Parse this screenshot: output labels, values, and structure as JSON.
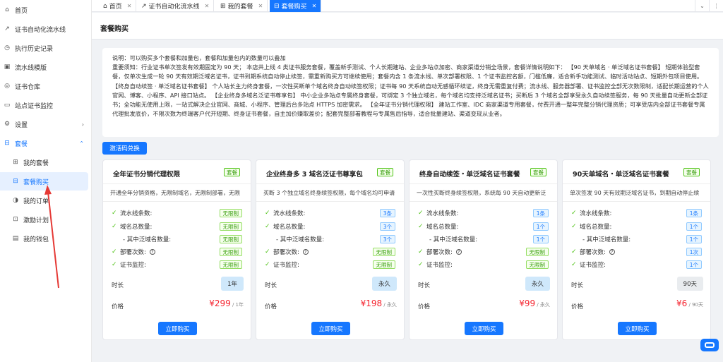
{
  "sidebar": {
    "items": [
      {
        "label": "首页",
        "icon": "home-icon",
        "glyph": "⌂"
      },
      {
        "label": "证书自动化流水线",
        "icon": "trend-icon",
        "glyph": "↗"
      },
      {
        "label": "执行历史记录",
        "icon": "history-icon",
        "glyph": "◷"
      },
      {
        "label": "流水线模版",
        "icon": "template-icon",
        "glyph": "▣"
      },
      {
        "label": "证书仓库",
        "icon": "shield-icon",
        "glyph": "◎"
      },
      {
        "label": "站点证书监控",
        "icon": "monitor-icon",
        "glyph": "▭"
      },
      {
        "label": "设置",
        "icon": "gear-icon",
        "glyph": "⚙"
      },
      {
        "label": "套餐",
        "icon": "cart-icon",
        "glyph": "⊟"
      },
      {
        "label": "我的套餐",
        "icon": "package-icon",
        "glyph": "⊞"
      },
      {
        "label": "套餐购买",
        "icon": "cart-icon",
        "glyph": "⊟"
      },
      {
        "label": "我的订单",
        "icon": "order-icon",
        "glyph": "◑"
      },
      {
        "label": "激励计划",
        "icon": "gift-icon",
        "glyph": "⊡"
      },
      {
        "label": "我的钱包",
        "icon": "wallet-icon",
        "glyph": "▤"
      }
    ]
  },
  "tabs": [
    {
      "label": "首页",
      "icon": "home-icon",
      "glyph": "⌂"
    },
    {
      "label": "证书自动化流水线",
      "icon": "trend-icon",
      "glyph": "↗"
    },
    {
      "label": "我的套餐",
      "icon": "package-icon",
      "glyph": "⊞"
    },
    {
      "label": "套餐购买",
      "icon": "cart-icon",
      "glyph": "⊟"
    }
  ],
  "page_title": "套餐购买",
  "notice": {
    "line1": "说明：可以购买多个套餐和加量包，套餐和加量包内的数量可以叠加",
    "body": "重要须知：行业证书单次签发有效期固定为 90 天； 本店共上线 4 类证书服务套餐，覆盖新手测试、个人长期建站、企业多站点加密、商家渠道分销全场景，套餐详情说明如下： 【90 天单域名 · 单泛域名证书套餐】 短期体验型套餐，仅单次生成一轮 90 天有效期泛域名证书，证书到期系统自动停止续签，需重新购买方可继续使用；套餐内含 1 条流水线、单次部署权限、1 个证书监控名额，门槛低廉，适合新手功能测试、临时活动站点、短期外包项目使用。 【终身自动续签 · 单泛域名证书套餐】 个人站长主力终身套餐，一次性买断单个域名终身自动续签权限；证书每 90 天系统自动无感循环续证，终身无需重复付费；流水线、服务器部署、证书监控全部无次数限制，适配长期运营的个人官网、博客、小程序、API 接口站点。 【企业终身多域名泛证书尊享包】 中小企业多站点专属终身套餐，可绑定 3 个独立域名，每个域名均支持泛域名证书；买断后 3 个域名全部享受永久自动续签服务，每 90 天批量自动更新全部证书；全功能无使用上限，一站式解决企业官网、商城、小程序、管理后台多站点 HTTPS 加密需求。 【全年证书分销代理权限】 建站工作室、IDC 商家渠道专用套餐，付费开通一整年完整分销代理资质；可享受店内全部证书套餐专属代理批发底价，不限次数为终端客户代开短期、终身证书套餐，自主加价赚取差价；配套完整部署教程与专属售后指导，适合批量建站、渠道变现从业者。"
  },
  "redeem_label": "激活码兑换",
  "tag_label": "套餐",
  "labels": {
    "pipelines": "流水线条数:",
    "domains": "域名总数量:",
    "wildcards": "- 其中泛域名数量:",
    "deploys": "部署次数:",
    "monitors": "证书监控:",
    "duration": "时长",
    "price": "价格",
    "buy": "立即购买",
    "deploy_help": "?"
  },
  "cards": [
    {
      "title": "全年证书分销代理权限",
      "desc": "开通全年分销资格，无限制域名，无限制部署，无限",
      "pipelines": "无限制",
      "domains": "无限制",
      "wildcards": "无限制",
      "deploys": "无限制",
      "monitors": "无限制",
      "badge_colors": [
        "green",
        "green",
        "green",
        "green",
        "green"
      ],
      "duration": "1年",
      "price": "¥299",
      "unit": " / 1年"
    },
    {
      "title": "企业终身多 3 域名泛证书尊享包",
      "desc": "买断 3 个独立域名终身续签权限，每个域名均可申请",
      "pipelines": "3条",
      "domains": "3个",
      "wildcards": "3个",
      "deploys": "无限制",
      "monitors": "无限制",
      "badge_colors": [
        "blue",
        "blue",
        "blue",
        "green",
        "green"
      ],
      "duration": "永久",
      "price": "¥198",
      "unit": " / 永久"
    },
    {
      "title": "终身自动续签・单泛域名证书套餐",
      "desc": "一次性买断终身续签权限，系统每 90 天自动更新泛",
      "pipelines": "1条",
      "domains": "1个",
      "wildcards": "1个",
      "deploys": "无限制",
      "monitors": "无限制",
      "badge_colors": [
        "blue",
        "blue",
        "blue",
        "green",
        "green"
      ],
      "duration": "永久",
      "price": "¥99",
      "unit": " / 永久"
    },
    {
      "title": "90天单域名・单泛域名证书套餐",
      "desc": "单次签发 90 天有效期泛域名证书，到期自动停止续",
      "pipelines": "1条",
      "domains": "1个",
      "wildcards": "1个",
      "deploys": "1次",
      "monitors": "1个",
      "badge_colors": [
        "blue",
        "blue",
        "blue",
        "blue",
        "blue"
      ],
      "duration": "90天",
      "price": "¥6",
      "unit": " / 90天"
    }
  ]
}
